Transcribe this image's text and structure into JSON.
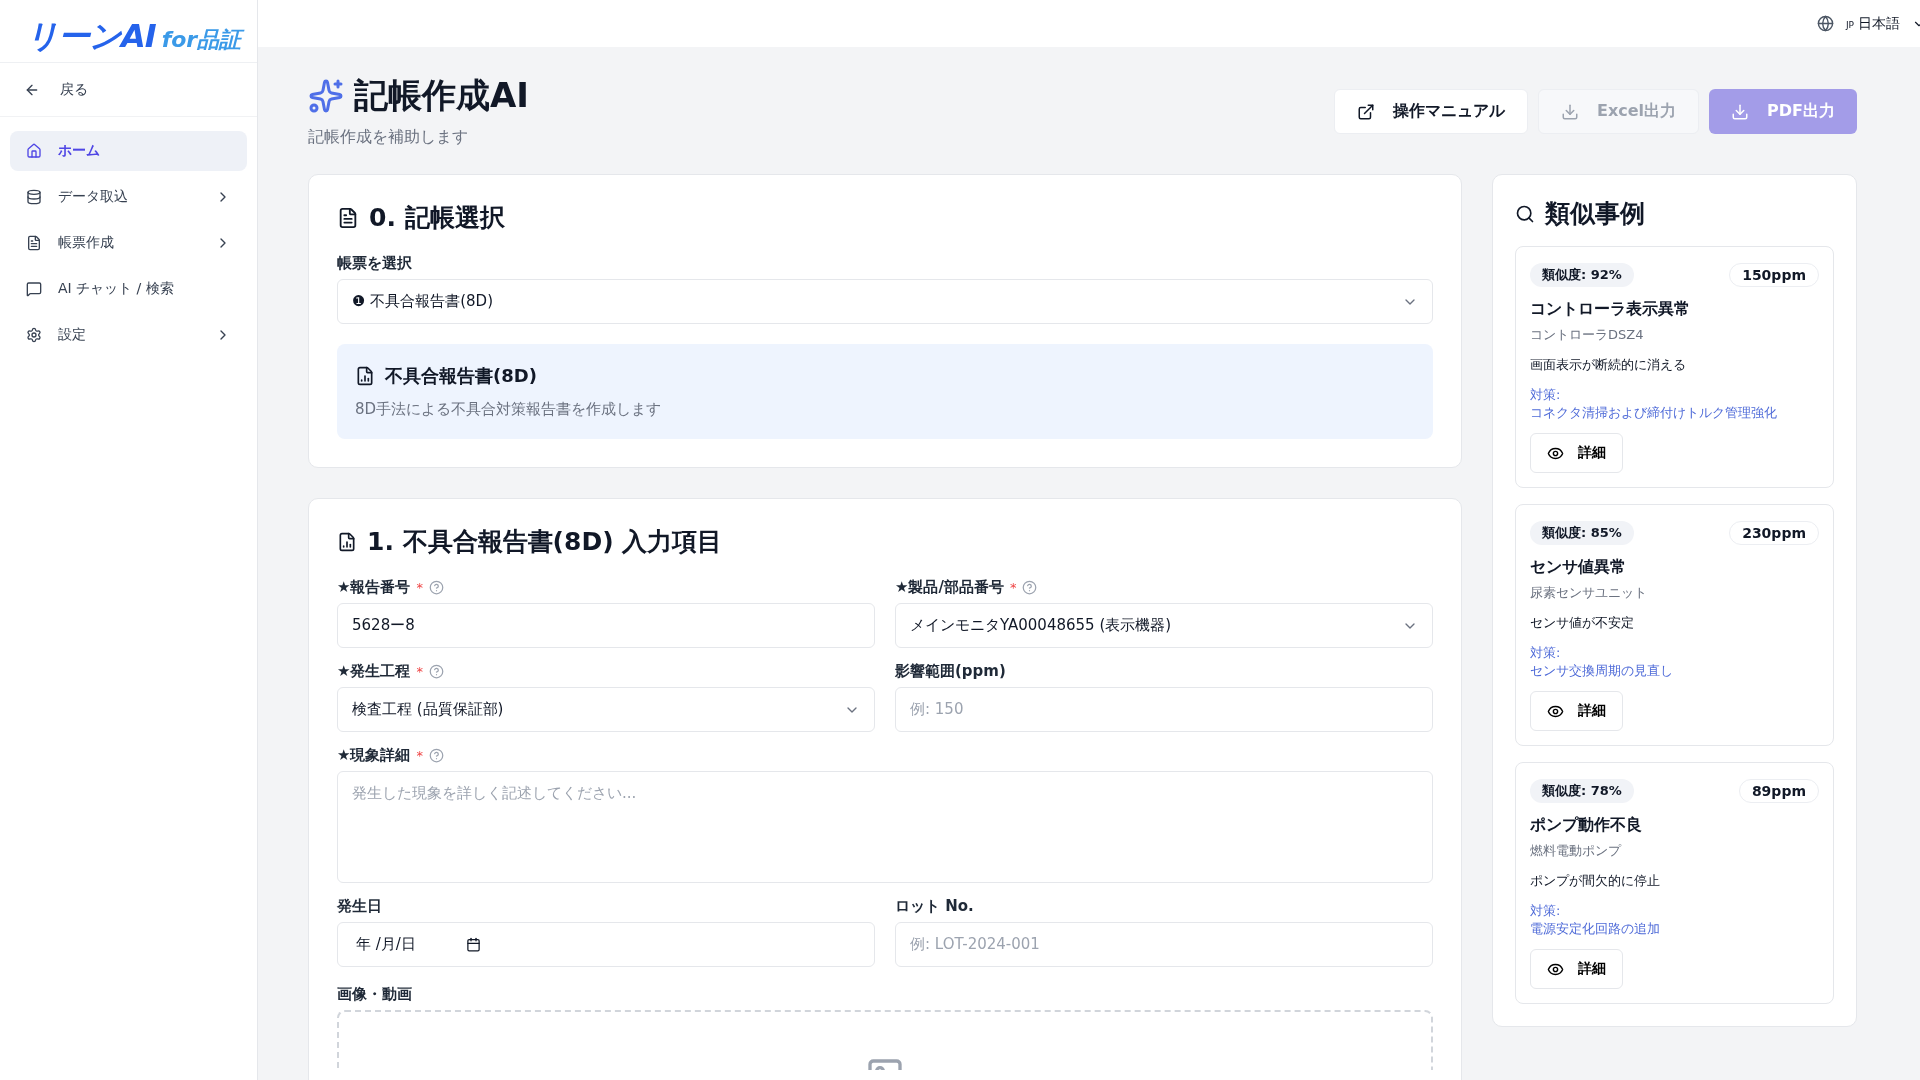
{
  "logo": {
    "main": "リーンAI",
    "sub": "for品証"
  },
  "sidebar": {
    "back": "戻る",
    "items": [
      {
        "label": "ホーム",
        "selected": true,
        "has_submenu": false
      },
      {
        "label": "データ取込",
        "selected": false,
        "has_submenu": true
      },
      {
        "label": "帳票作成",
        "selected": false,
        "has_submenu": true
      },
      {
        "label": "AI チャット / 検索",
        "selected": false,
        "has_submenu": false
      },
      {
        "label": "設定",
        "selected": false,
        "has_submenu": true
      }
    ]
  },
  "header": {
    "language_code": "JP",
    "language": "日本語"
  },
  "page": {
    "title": "記帳作成AI",
    "subtitle": "記帳作成を補助します"
  },
  "actions": [
    {
      "label": "操作マニュアル",
      "kind": "outline",
      "disabled": false
    },
    {
      "label": "Excel出力",
      "kind": "outline",
      "disabled": true
    },
    {
      "label": "PDF出力",
      "kind": "primary",
      "disabled": true
    }
  ],
  "selection": {
    "title": "0. 記帳選択",
    "select_label": "帳票を選択",
    "select_value": "❶ 不具合報告書(8D)",
    "info_title": "不具合報告書(8D)",
    "info_text": "8D手法による不具合対策報告書を作成します"
  },
  "form": {
    "title": "1. 不具合報告書(8D) 入力項目",
    "fields": [
      {
        "kind": "input",
        "label": "★報告番号",
        "required_mark": "*",
        "help": true,
        "value": "5628ー8"
      },
      {
        "kind": "select",
        "label": "★製品/部品番号",
        "required_mark": "*",
        "help": true,
        "value": "メインモニタYA00048655 (表示機器)"
      },
      {
        "kind": "select",
        "label": "★発生工程",
        "required_mark": "*",
        "help": true,
        "value": "検査工程 (品質保証部)"
      },
      {
        "kind": "input",
        "label": "影響範囲(ppm)",
        "help": false,
        "placeholder": "例: 150"
      },
      {
        "kind": "textarea",
        "label": "★現象詳細",
        "required_mark": "*",
        "help": true,
        "placeholder": "発生した現象を詳しく記述してください..."
      },
      {
        "kind": "date",
        "label": "発生日",
        "help": false,
        "placeholder": "年 /月/日"
      },
      {
        "kind": "input",
        "label": "ロット No.",
        "help": false,
        "placeholder": "例: LOT-2024-001"
      }
    ],
    "upload_label": "画像・動画"
  },
  "similar": {
    "title": "類似事例",
    "cases": [
      {
        "similarity": "類似度: 92%",
        "ppm": "150ppm",
        "title": "コントローラ表示異常",
        "part": "コントローラDSZ4",
        "symptom": "画面表示が断続的に消える",
        "measure_label": "対策:",
        "measure": "コネクタ清掃および締付けトルク管理強化",
        "button": "詳細"
      },
      {
        "similarity": "類似度: 85%",
        "ppm": "230ppm",
        "title": "センサ値異常",
        "part": "尿素センサユニット",
        "symptom": "センサ値が不安定",
        "measure_label": "対策:",
        "measure": "センサ交換周期の見直し",
        "button": "詳細"
      },
      {
        "similarity": "類似度: 78%",
        "ppm": "89ppm",
        "title": "ポンプ動作不良",
        "part": "燃料電動ポンプ",
        "symptom": "ポンプが間欠的に停止",
        "measure_label": "対策:",
        "measure": "電源安定化回路の追加",
        "button": "詳細"
      }
    ]
  }
}
